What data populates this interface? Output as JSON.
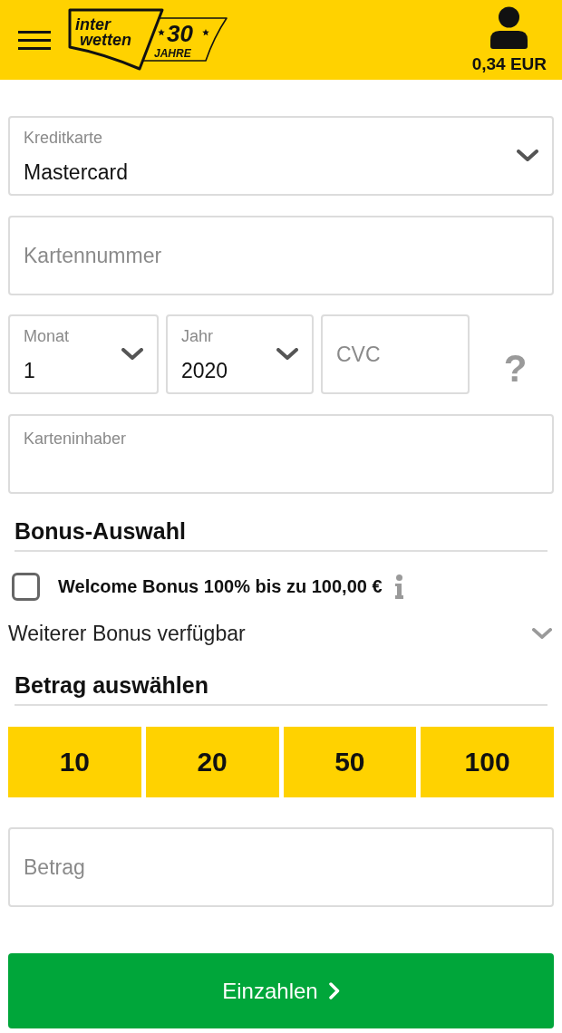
{
  "header": {
    "logo": {
      "line1": "inter",
      "line2": "wetten",
      "badge": "30",
      "badge_sub": "JAHRE"
    },
    "balance": "0,34 EUR"
  },
  "card_type": {
    "label": "Kreditkarte",
    "value": "Mastercard"
  },
  "card_number": {
    "placeholder": "Kartennummer"
  },
  "expiry": {
    "month": {
      "label": "Monat",
      "value": "1"
    },
    "year": {
      "label": "Jahr",
      "value": "2020"
    },
    "cvc": {
      "placeholder": "CVC"
    },
    "help": "?"
  },
  "card_holder": {
    "label": "Karteninhaber"
  },
  "bonus_section": {
    "title": "Bonus-Auswahl",
    "bonuses": [
      {
        "label": "Welcome Bonus 100% bis zu 100,00 €",
        "checked": false
      }
    ],
    "more_bonus": {
      "label": "Weiterer Bonus verfügbar",
      "expanded": false
    }
  },
  "amount_section": {
    "title": "Betrag auswählen",
    "presets": [
      {
        "label": "10",
        "selected": false
      },
      {
        "label": "20",
        "selected": false
      },
      {
        "label": "50",
        "selected": false
      },
      {
        "label": "100",
        "selected": false
      }
    ],
    "amount": {
      "placeholder": "Betrag"
    }
  },
  "submit_button": {
    "label": "Einzahlen"
  }
}
